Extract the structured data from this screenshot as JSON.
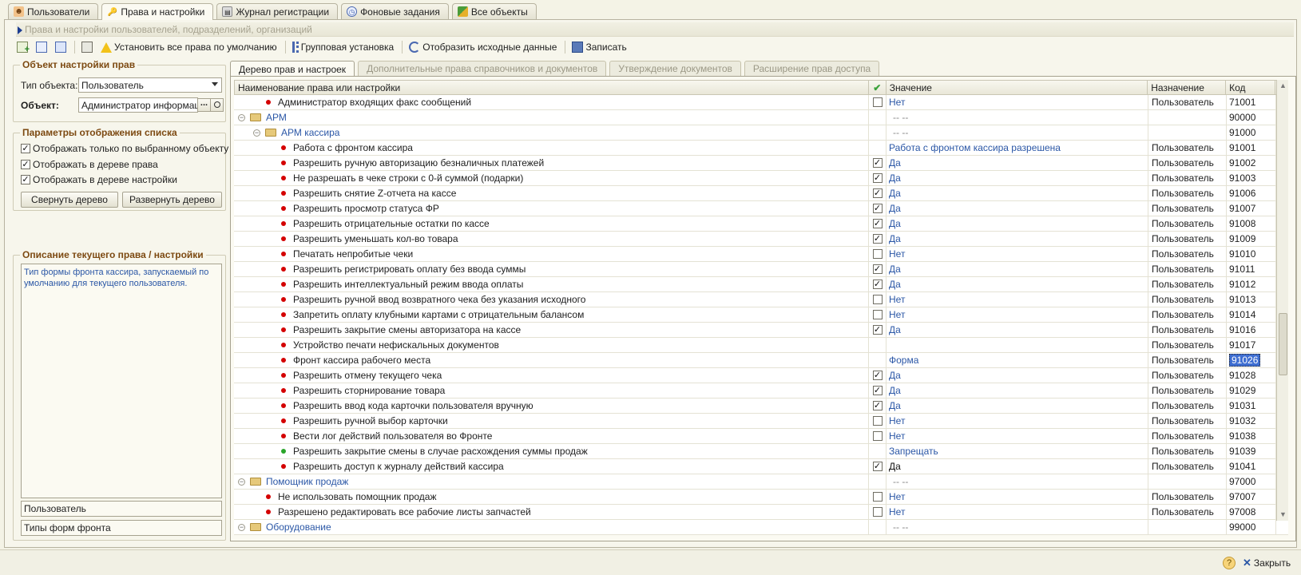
{
  "top_tabs": [
    {
      "label": "Пользователи",
      "icon": "user-icon",
      "active": false
    },
    {
      "label": "Права и настройки",
      "icon": "key-icon",
      "active": true
    },
    {
      "label": "Журнал регистрации",
      "icon": "log-icon",
      "active": false
    },
    {
      "label": "Фоновые задания",
      "icon": "clock-icon",
      "active": false
    },
    {
      "label": "Все объекты",
      "icon": "objects-icon",
      "active": false
    }
  ],
  "page_title": "Права и настройки пользователей, подразделений, организаций",
  "toolbar": {
    "set_default_label": "Установить все права по умолчанию",
    "group_set_label": "Групповая установка",
    "show_source_label": "Отобразить исходные данные",
    "save_label": "Записать"
  },
  "object_group": {
    "title": "Объект настройки прав",
    "type_label": "Тип объекта:",
    "type_value": "Пользователь",
    "object_label": "Объект:",
    "object_value": "Администратор информационной базы"
  },
  "display_group": {
    "title": "Параметры отображения списка",
    "options": [
      {
        "label": "Отображать только по  выбранному объекту",
        "checked": true
      },
      {
        "label": "Отображать в дереве права",
        "checked": true
      },
      {
        "label": "Отображать в дереве настройки",
        "checked": true
      }
    ],
    "collapse_label": "Свернуть дерево",
    "expand_label": "Развернуть дерево"
  },
  "description_group": {
    "title": "Описание текущего права / настройки",
    "text": "Тип формы фронта кассира, запускаемый по умолчанию для текущего пользователя.",
    "field1": "Пользователь",
    "field2": "Типы форм фронта"
  },
  "inner_tabs": [
    {
      "label": "Дерево прав и настроек",
      "active": true
    },
    {
      "label": "Дополнительные права справочников и документов",
      "active": false
    },
    {
      "label": "Утверждение документов",
      "active": false
    },
    {
      "label": "Расширение прав доступа",
      "active": false
    }
  ],
  "grid": {
    "headers": {
      "name": "Наименование права или настройки",
      "value": "Значение",
      "dest": "Назначение",
      "code": "Код"
    },
    "rows": [
      {
        "kind": "item",
        "level": 1,
        "dot": "red",
        "name": "Администратор входящих факс сообщений",
        "check": "unchecked",
        "value": "Нет",
        "dest": "Пользователь",
        "code": "71001"
      },
      {
        "kind": "folder",
        "level": 0,
        "name": "АРМ",
        "value": "-- --",
        "dest": "",
        "code": "90000"
      },
      {
        "kind": "folder",
        "level": 1,
        "name": "АРМ кассира",
        "value": "-- --",
        "dest": "",
        "code": "91000"
      },
      {
        "kind": "item",
        "level": 2,
        "dot": "red",
        "name": "Работа с фронтом кассира",
        "check": "none",
        "value": "Работа с фронтом кассира разрешена",
        "dest": "Пользователь",
        "code": "91001"
      },
      {
        "kind": "item",
        "level": 2,
        "dot": "red",
        "name": "Разрешить ручную авторизацию безналичных платежей",
        "check": "checked",
        "value": "Да",
        "dest": "Пользователь",
        "code": "91002"
      },
      {
        "kind": "item",
        "level": 2,
        "dot": "red",
        "name": "Не разрешать в чеке строки с 0-й суммой (подарки)",
        "check": "checked",
        "value": "Да",
        "dest": "Пользователь",
        "code": "91003"
      },
      {
        "kind": "item",
        "level": 2,
        "dot": "red",
        "name": "Разрешить снятие Z-отчета на кассе",
        "check": "checked",
        "value": "Да",
        "dest": "Пользователь",
        "code": "91006"
      },
      {
        "kind": "item",
        "level": 2,
        "dot": "red",
        "name": "Разрешить просмотр статуса ФР",
        "check": "checked",
        "value": "Да",
        "dest": "Пользователь",
        "code": "91007"
      },
      {
        "kind": "item",
        "level": 2,
        "dot": "red",
        "name": "Разрешить отрицательные остатки по кассе",
        "check": "checked",
        "value": "Да",
        "dest": "Пользователь",
        "code": "91008"
      },
      {
        "kind": "item",
        "level": 2,
        "dot": "red",
        "name": "Разрешить уменьшать кол-во товара",
        "check": "checked",
        "value": "Да",
        "dest": "Пользователь",
        "code": "91009"
      },
      {
        "kind": "item",
        "level": 2,
        "dot": "red",
        "name": "Печатать непробитые чеки",
        "check": "unchecked",
        "value": "Нет",
        "dest": "Пользователь",
        "code": "91010"
      },
      {
        "kind": "item",
        "level": 2,
        "dot": "red",
        "name": "Разрешить регистрировать оплату без ввода суммы",
        "check": "checked",
        "value": "Да",
        "dest": "Пользователь",
        "code": "91011"
      },
      {
        "kind": "item",
        "level": 2,
        "dot": "red",
        "name": "Разрешить интеллектуальный режим ввода оплаты",
        "check": "checked",
        "value": "Да",
        "dest": "Пользователь",
        "code": "91012"
      },
      {
        "kind": "item",
        "level": 2,
        "dot": "red",
        "name": "Разрешить ручной ввод возвратного чека без указания исходного",
        "check": "unchecked",
        "value": "Нет",
        "dest": "Пользователь",
        "code": "91013"
      },
      {
        "kind": "item",
        "level": 2,
        "dot": "red",
        "name": "Запретить оплату клубными картами с отрицательным балансом",
        "check": "unchecked",
        "value": "Нет",
        "dest": "Пользователь",
        "code": "91014"
      },
      {
        "kind": "item",
        "level": 2,
        "dot": "red",
        "name": "Разрешить закрытие смены авторизатора на кассе",
        "check": "checked",
        "value": "Да",
        "dest": "Пользователь",
        "code": "91016"
      },
      {
        "kind": "item",
        "level": 2,
        "dot": "red",
        "name": "Устройство печати нефискальных документов",
        "check": "none",
        "value": "",
        "dest": "Пользователь",
        "code": "91017"
      },
      {
        "kind": "item",
        "level": 2,
        "dot": "red",
        "name": "Фронт кассира рабочего места",
        "check": "none",
        "value": "Форма",
        "dest": "Пользователь",
        "code": "91026",
        "selected": true
      },
      {
        "kind": "item",
        "level": 2,
        "dot": "red",
        "name": "Разрешить отмену текущего чека",
        "check": "checked",
        "value": "Да",
        "dest": "Пользователь",
        "code": "91028"
      },
      {
        "kind": "item",
        "level": 2,
        "dot": "red",
        "name": "Разрешить сторнирование товара",
        "check": "checked",
        "value": "Да",
        "dest": "Пользователь",
        "code": "91029"
      },
      {
        "kind": "item",
        "level": 2,
        "dot": "red",
        "name": "Разрешить ввод кода карточки пользователя вручную",
        "check": "checked",
        "value": "Да",
        "dest": "Пользователь",
        "code": "91031"
      },
      {
        "kind": "item",
        "level": 2,
        "dot": "red",
        "name": "Разрешить ручной выбор карточки",
        "check": "unchecked",
        "value": "Нет",
        "dest": "Пользователь",
        "code": "91032"
      },
      {
        "kind": "item",
        "level": 2,
        "dot": "red",
        "name": "Вести лог действий пользователя во Фронте",
        "check": "unchecked",
        "value": "Нет",
        "dest": "Пользователь",
        "code": "91038"
      },
      {
        "kind": "item",
        "level": 2,
        "dot": "green",
        "name": "Разрешить закрытие смены в случае расхождения суммы продаж",
        "check": "none",
        "value": "Запрещать",
        "dest": "Пользователь",
        "code": "91039"
      },
      {
        "kind": "item",
        "level": 2,
        "dot": "red",
        "name": "Разрешить доступ к журналу действий кассира",
        "check": "checked",
        "value": "Да",
        "dest": "Пользователь",
        "code": "91041",
        "plain": true
      },
      {
        "kind": "folder",
        "level": 0,
        "name": "Помощник продаж",
        "value": "-- --",
        "dest": "",
        "code": "97000"
      },
      {
        "kind": "item",
        "level": 1,
        "dot": "red",
        "name": "Не использовать помощник продаж",
        "check": "unchecked",
        "value": "Нет",
        "dest": "Пользователь",
        "code": "97007"
      },
      {
        "kind": "item",
        "level": 1,
        "dot": "red",
        "name": "Разрешено редактировать все рабочие листы запчастей",
        "check": "unchecked",
        "value": "Нет",
        "dest": "Пользователь",
        "code": "97008"
      },
      {
        "kind": "folder",
        "level": 0,
        "name": "Оборудование",
        "value": "-- --",
        "dest": "",
        "code": "99000"
      }
    ]
  },
  "bottom": {
    "close_label": "Закрыть",
    "help_label": "?"
  },
  "colors": {
    "accent": "#2b57a6",
    "group_title": "#7d4a12",
    "red_dot": "#d40000",
    "green_dot": "#2aa52a",
    "selection": "#3e6ed2"
  }
}
